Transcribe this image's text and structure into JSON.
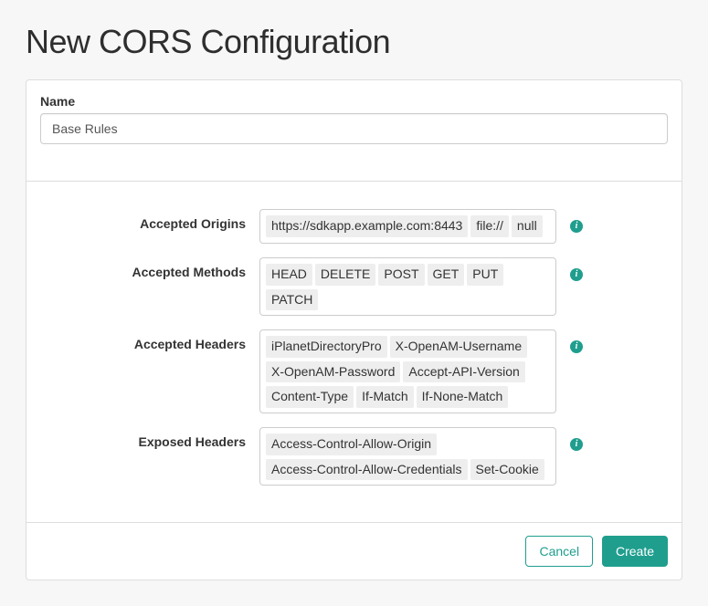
{
  "page": {
    "title": "New CORS Configuration"
  },
  "form": {
    "name": {
      "label": "Name",
      "value": "Base Rules"
    },
    "accepted_origins": {
      "label": "Accepted Origins",
      "tags": [
        "https://sdkapp.example.com:8443",
        "file://",
        "null"
      ]
    },
    "accepted_methods": {
      "label": "Accepted Methods",
      "tags": [
        "HEAD",
        "DELETE",
        "POST",
        "GET",
        "PUT",
        "PATCH"
      ]
    },
    "accepted_headers": {
      "label": "Accepted Headers",
      "tags": [
        "iPlanetDirectoryPro",
        "X-OpenAM-Username",
        "X-OpenAM-Password",
        "Accept-API-Version",
        "Content-Type",
        "If-Match",
        "If-None-Match"
      ]
    },
    "exposed_headers": {
      "label": "Exposed Headers",
      "tags": [
        "Access-Control-Allow-Origin",
        "Access-Control-Allow-Credentials",
        "Set-Cookie"
      ]
    }
  },
  "buttons": {
    "cancel": "Cancel",
    "create": "Create"
  }
}
